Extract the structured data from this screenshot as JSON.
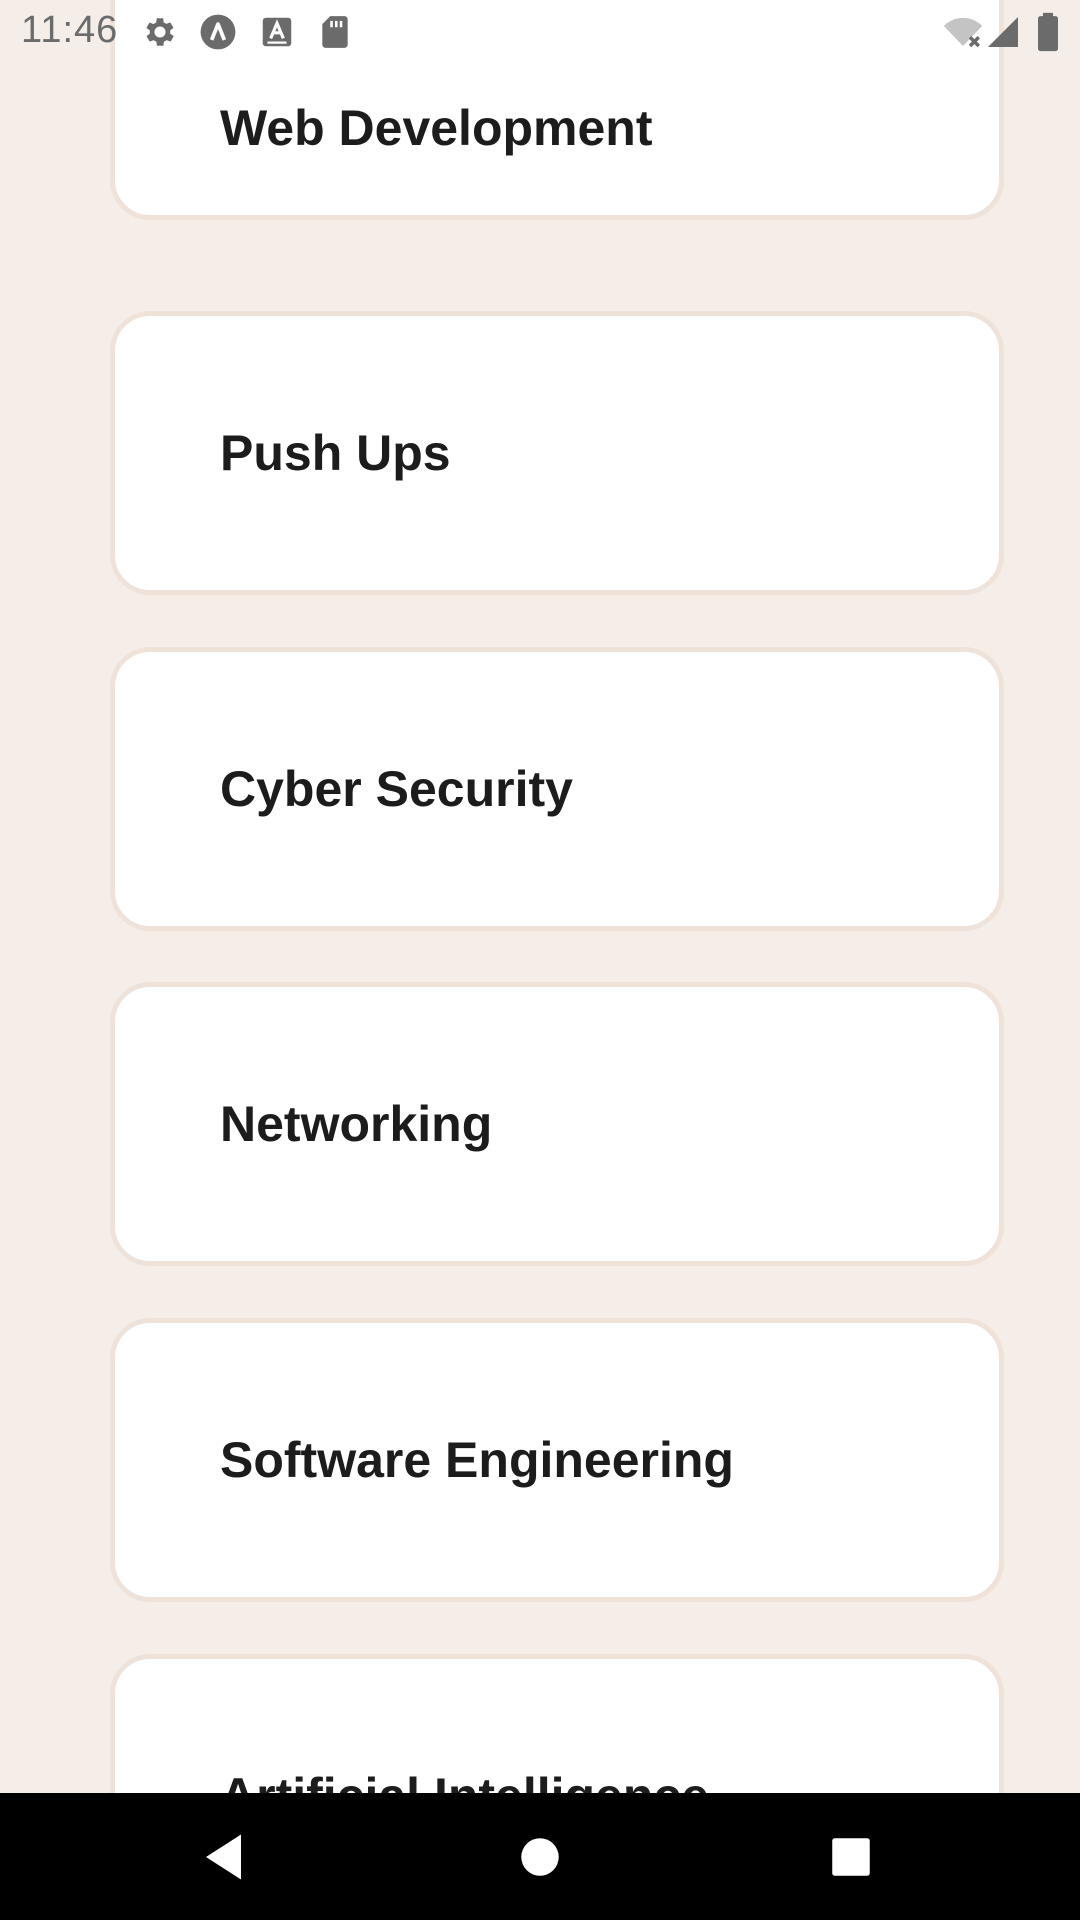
{
  "status_bar": {
    "time": "11:46",
    "left_icons": [
      "gear-icon",
      "a-circle-icon",
      "a-box-icon",
      "sd-card-icon"
    ],
    "right_icons": [
      "wifi-off-icon",
      "signal-icon",
      "battery-icon"
    ]
  },
  "cards": [
    {
      "label": "Web Development"
    },
    {
      "label": "Push Ups"
    },
    {
      "label": "Cyber Security"
    },
    {
      "label": "Networking"
    },
    {
      "label": "Software Engineering"
    },
    {
      "label": "Artificial Intelligence"
    }
  ],
  "nav_bar": {
    "buttons": [
      "back-icon",
      "home-icon",
      "recents-icon"
    ]
  },
  "colors": {
    "background": "#f5eee8",
    "card": "#ffffff",
    "card_border": "#efe2d8",
    "text": "#1c1c1c"
  }
}
